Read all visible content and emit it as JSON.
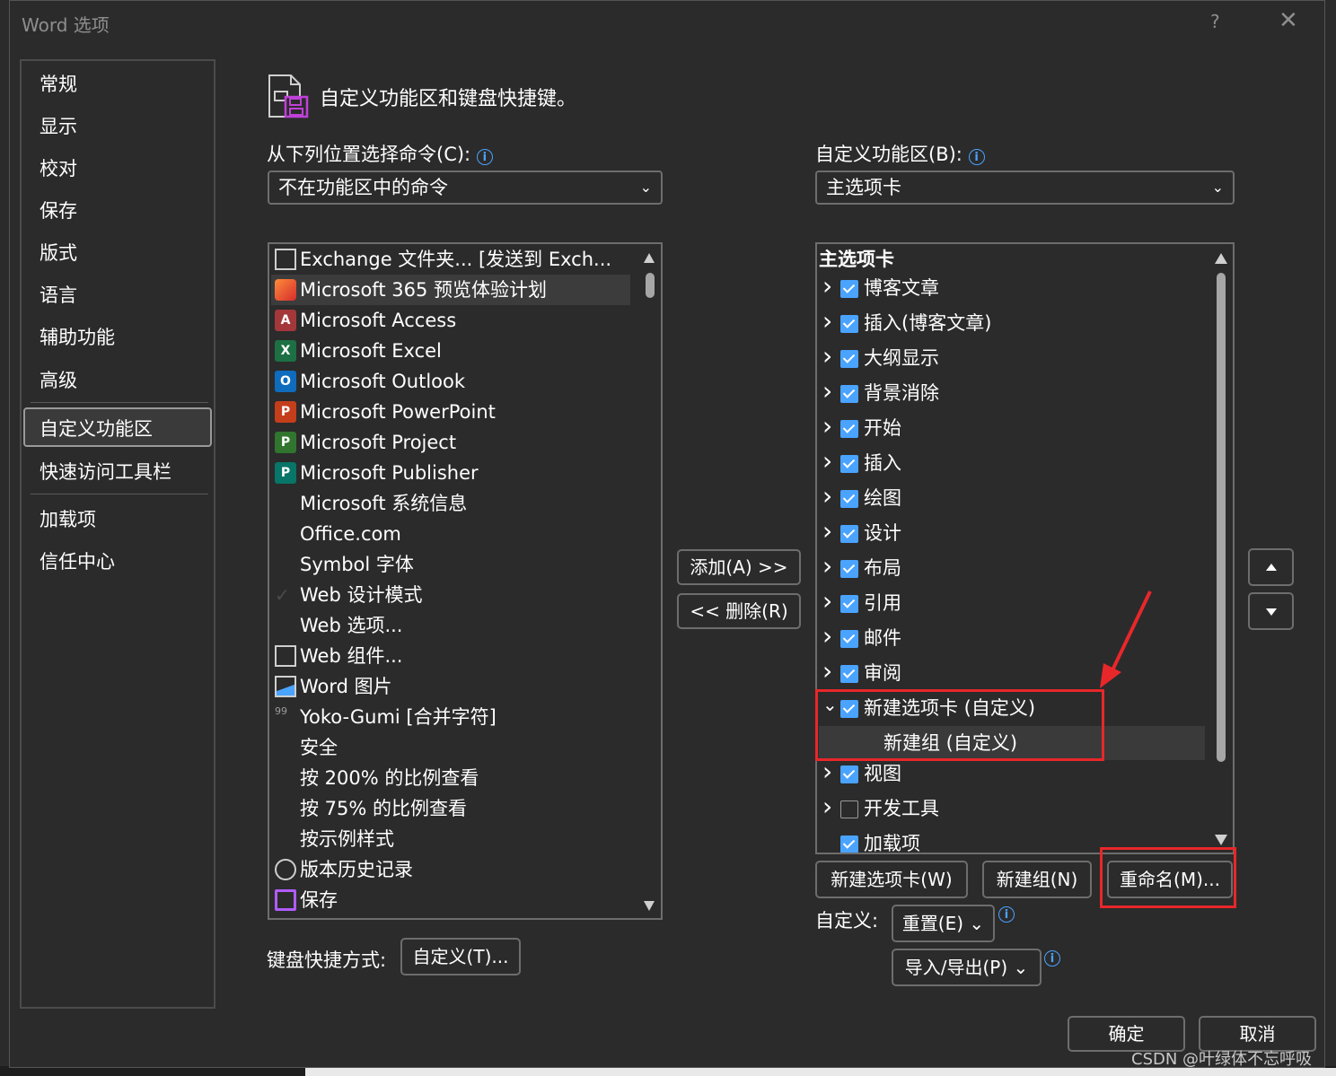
{
  "window": {
    "title": "Word 选项",
    "help": "?",
    "close": "✕"
  },
  "nav": {
    "items": [
      "常规",
      "显示",
      "校对",
      "保存",
      "版式",
      "语言",
      "辅助功能",
      "高级"
    ],
    "selected": "自定义功能区",
    "items2": [
      "快速访问工具栏"
    ],
    "items3": [
      "加载项",
      "信任中心"
    ]
  },
  "header": {
    "title": "自定义功能区和键盘快捷键。"
  },
  "left": {
    "label": "从下列位置选择命令(C):",
    "select_value": "不在功能区中的命令",
    "commands": [
      {
        "label": "Exchange 文件夹... [发送到 Exch...",
        "icon": "exchange-icon",
        "color": "#4aa3ff"
      },
      {
        "label": "Microsoft 365 预览体验计划",
        "icon": "office-icon",
        "color": "#e8472a"
      },
      {
        "label": "Microsoft Access",
        "icon": "access-icon",
        "color": "#a4373a",
        "letter": "A"
      },
      {
        "label": "Microsoft Excel",
        "icon": "excel-icon",
        "color": "#1d7044",
        "letter": "X"
      },
      {
        "label": "Microsoft Outlook",
        "icon": "outlook-icon",
        "color": "#0f6cbd",
        "letter": "O"
      },
      {
        "label": "Microsoft PowerPoint",
        "icon": "powerpoint-icon",
        "color": "#c43e1c",
        "letter": "P"
      },
      {
        "label": "Microsoft Project",
        "icon": "project-icon",
        "color": "#31752f",
        "letter": "P"
      },
      {
        "label": "Microsoft Publisher",
        "icon": "publisher-icon",
        "color": "#077568",
        "letter": "P"
      },
      {
        "label": "Microsoft 系统信息",
        "icon": ""
      },
      {
        "label": "Office.com",
        "icon": ""
      },
      {
        "label": "Symbol 字体",
        "icon": ""
      },
      {
        "label": "Web 设计模式",
        "icon": "check-icon",
        "color": "#3a3a3a"
      },
      {
        "label": "Web 选项...",
        "icon": ""
      },
      {
        "label": "Web 组件...",
        "icon": "web-component-icon",
        "color": "#4aa3ff"
      },
      {
        "label": "Word 图片",
        "icon": "picture-icon",
        "color": "#4aa3ff"
      },
      {
        "label": "Yoko-Gumi [合并字符]",
        "icon": "combine-chars-icon",
        "color": "#9a9a9a"
      },
      {
        "label": "安全",
        "icon": ""
      },
      {
        "label": "按 200% 的比例查看",
        "icon": ""
      },
      {
        "label": "按 75% 的比例查看",
        "icon": ""
      },
      {
        "label": "按示例样式",
        "icon": ""
      },
      {
        "label": "版本历史记录",
        "icon": "history-icon",
        "color": "#cfcfcf"
      },
      {
        "label": "保存",
        "icon": "save-icon",
        "color": "#b15cff"
      }
    ]
  },
  "middle": {
    "add": "添加(A) >>",
    "remove": "<< 删除(R)"
  },
  "right": {
    "label": "自定义功能区(B):",
    "select_value": "主选项卡",
    "tree_header": "主选项卡",
    "tabs": [
      {
        "label": "博客文章",
        "checked": true,
        "expanded": false
      },
      {
        "label": "插入(博客文章)",
        "checked": true,
        "expanded": false
      },
      {
        "label": "大纲显示",
        "checked": true,
        "expanded": false
      },
      {
        "label": "背景消除",
        "checked": true,
        "expanded": false
      },
      {
        "label": "开始",
        "checked": true,
        "expanded": false
      },
      {
        "label": "插入",
        "checked": true,
        "expanded": false
      },
      {
        "label": "绘图",
        "checked": true,
        "expanded": false
      },
      {
        "label": "设计",
        "checked": true,
        "expanded": false
      },
      {
        "label": "布局",
        "checked": true,
        "expanded": false
      },
      {
        "label": "引用",
        "checked": true,
        "expanded": false
      },
      {
        "label": "邮件",
        "checked": true,
        "expanded": false
      },
      {
        "label": "审阅",
        "checked": true,
        "expanded": false
      },
      {
        "label": "新建选项卡 (自定义)",
        "checked": true,
        "expanded": true
      },
      {
        "label": "新建组 (自定义)",
        "group": true
      },
      {
        "label": "视图",
        "checked": true,
        "expanded": false
      },
      {
        "label": "开发工具",
        "checked": false,
        "expanded": false
      },
      {
        "label": "加载项",
        "checked": true,
        "expanded": null
      }
    ],
    "new_tab": "新建选项卡(W)",
    "new_group": "新建组(N)",
    "rename": "重命名(M)...",
    "customize_label": "自定义:",
    "reset": "重置(E) ⌄",
    "import_export": "导入/导出(P) ⌄"
  },
  "keyboard": {
    "label": "键盘快捷方式:",
    "button": "自定义(T)..."
  },
  "footer": {
    "ok": "确定",
    "cancel": "取消"
  },
  "watermark": "CSDN @叶绿体不忘呼吸",
  "colors": {
    "accent": "#4aa3ff",
    "annotation": "#e8272a",
    "bg": "#2b2b2b"
  }
}
